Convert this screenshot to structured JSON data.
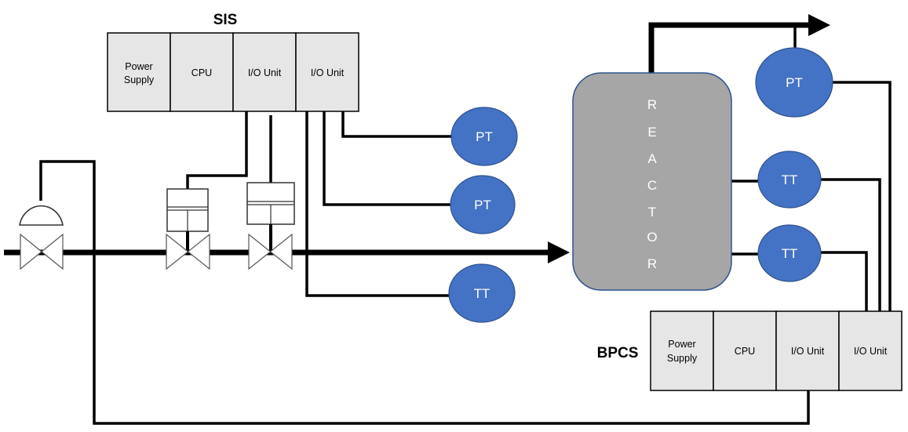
{
  "sis": {
    "title": "SIS",
    "modules": [
      "Power|Supply",
      "CPU",
      "I/O Unit",
      "I/O Unit"
    ]
  },
  "bpcs": {
    "title": "BPCS",
    "modules": [
      "Power|Supply",
      "CPU",
      "I/O Unit",
      "I/O Unit"
    ]
  },
  "reactor": {
    "label": "REACTOR",
    "letters": [
      "R",
      "E",
      "A",
      "C",
      "T",
      "O",
      "R"
    ]
  },
  "instruments": {
    "sis_pt_1": "PT",
    "sis_pt_2": "PT",
    "sis_tt": "TT",
    "bpcs_pt": "PT",
    "bpcs_tt_1": "TT",
    "bpcs_tt_2": "TT"
  },
  "colors": {
    "instrument_fill": "#4472c4",
    "reactor_fill": "#a6a6a6",
    "module_fill": "#e6e6e6"
  }
}
